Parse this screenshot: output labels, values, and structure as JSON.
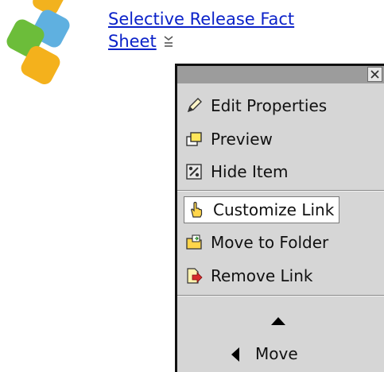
{
  "document_link": {
    "line1": "Selective Release Fact",
    "line2": "Sheet",
    "link_color": "#0b22c9"
  },
  "menu": {
    "items": [
      {
        "label": "Edit Properties",
        "icon": "pencil-icon"
      },
      {
        "label": "Preview",
        "icon": "preview-window-icon"
      },
      {
        "label": "Hide Item",
        "icon": "hide-item-icon"
      },
      {
        "label": "Customize Link",
        "icon": "pointing-hand-icon",
        "highlighted": true
      },
      {
        "label": "Move to Folder",
        "icon": "folder-move-icon"
      },
      {
        "label": "Remove Link",
        "icon": "document-remove-icon"
      }
    ],
    "move_label": "Move",
    "close_icon": "close-icon"
  },
  "colors": {
    "menu_background": "#d6d6d6",
    "titlebar": "#9c9c9c",
    "highlight": "#ffffff"
  }
}
